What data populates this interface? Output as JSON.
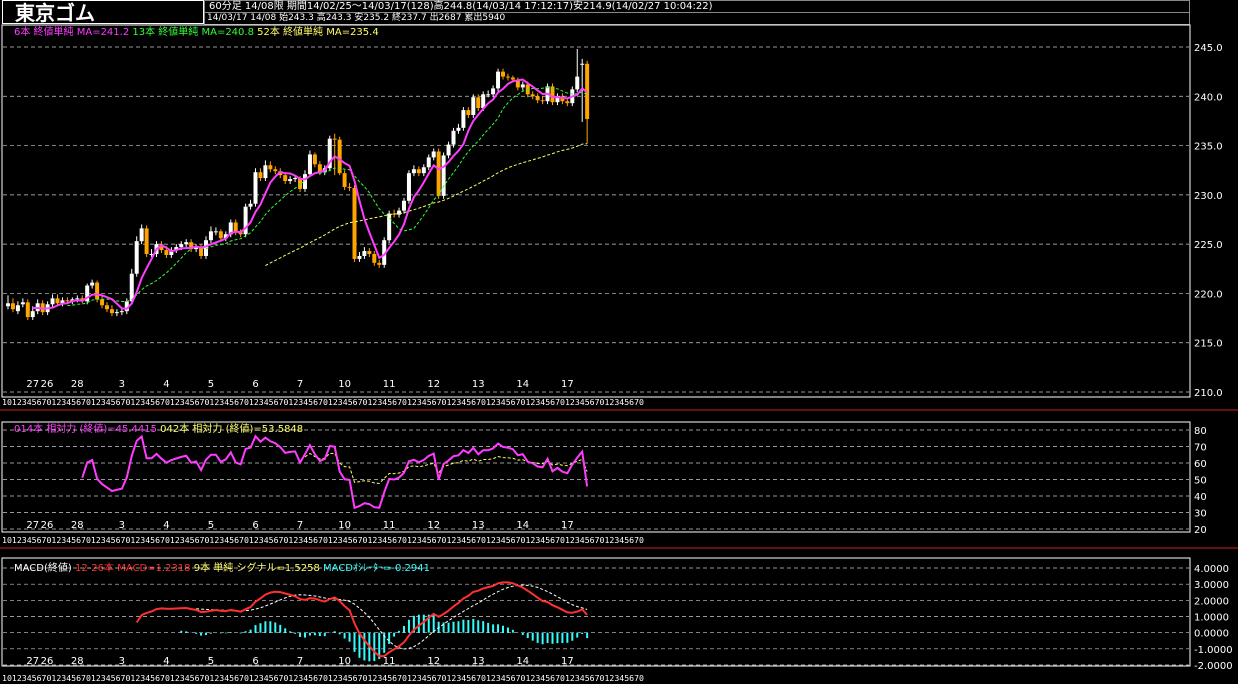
{
  "header": {
    "title": "東京ゴム",
    "info1": "60分足 14/08限 期間14/02/25～14/03/17(128)高244.8(14/03/14 17:12:17)安214.9(14/02/27 10:04:22)",
    "info2": "14/03/17 14/08 始243.3 高243.3 安235.2 終237.7 出2687 累出5940",
    "ma_labels": [
      {
        "text": "6本 終値単純 MA=241.2",
        "color": "#ff3cff"
      },
      {
        "text": "13本 終値単純 MA=240.8",
        "color": "#33ff33"
      },
      {
        "text": "52本 終値単純 MA=235.4",
        "color": "#ffff66"
      }
    ],
    "rsi_labels": [
      {
        "text": "014本 相対力 (終値)=45.4415",
        "color": "#ff3cff"
      },
      {
        "text": "042本 相対力 (終値)=53.5848",
        "color": "#ffff66"
      }
    ],
    "macd_labels": [
      {
        "text": "MACD(終値)",
        "color": "#ffffff"
      },
      {
        "text": "12-26本 MACD=1.2318",
        "color": "#ff3030"
      },
      {
        "text": "9本 単純 シグナル=1.5258",
        "color": "#ffff66"
      },
      {
        "text": "MACDｵｼﾚｰﾀｰ=-0.2941",
        "color": "#33ffff"
      }
    ]
  },
  "hour_ticks": "1012345670123456701234567012345670123456701234567012345670123456701234567012345670123456701234567012345670123456701234567012345670",
  "chart_data": [
    {
      "type": "candlestick",
      "name": "price",
      "ylim": [
        210,
        245
      ],
      "yticks": [
        "245.0",
        "240.0",
        "235.0",
        "230.0",
        "225.0",
        "220.0",
        "215.0",
        "210.0"
      ],
      "days": [
        "26",
        "27",
        "28",
        "3",
        "4",
        "5",
        "6",
        "7",
        "10",
        "11",
        "12",
        "13",
        "14",
        "17"
      ],
      "close": [
        219.0,
        218.4,
        218.8,
        219.1,
        217.6,
        218.2,
        219.0,
        218.1,
        218.9,
        219.5,
        219.0,
        219.3,
        219.2,
        219.4,
        219.5,
        219.2,
        220.8,
        221.1,
        219.4,
        218.8,
        218.4,
        218.0,
        218.1,
        218.2,
        219.2,
        222.0,
        225.3,
        226.6,
        224.0,
        224.0,
        225.0,
        224.4,
        223.9,
        224.4,
        224.7,
        225.0,
        225.2,
        224.5,
        224.7,
        223.8,
        225.4,
        226.3,
        226.3,
        225.6,
        226.0,
        227.2,
        226.2,
        226.0,
        228.8,
        229.1,
        232.3,
        231.7,
        233.0,
        232.6,
        232.4,
        232.0,
        231.4,
        231.6,
        231.7,
        230.6,
        232.1,
        234.1,
        233.1,
        232.3,
        232.7,
        235.7,
        235.6,
        232.2,
        230.8,
        230.7,
        223.5,
        223.8,
        224.3,
        224.0,
        223.1,
        222.9,
        225.4,
        228.1,
        228.0,
        228.4,
        229.4,
        232.2,
        232.6,
        232.2,
        232.8,
        233.8,
        234.4,
        229.9,
        234.0,
        235.1,
        236.5,
        236.8,
        238.6,
        238.1,
        239.9,
        238.8,
        240.2,
        240.2,
        240.8,
        242.5,
        242.0,
        241.9,
        241.7,
        240.9,
        241.2,
        240.2,
        240.0,
        239.6,
        239.5,
        241.0,
        239.4,
        240.0,
        239.5,
        239.3,
        240.7,
        242.0,
        243.3,
        237.7
      ],
      "open": [
        218.7,
        219.0,
        218.2,
        218.9,
        219.1,
        217.6,
        218.2,
        219.0,
        218.1,
        218.9,
        219.5,
        219.0,
        219.3,
        219.2,
        219.4,
        219.5,
        219.2,
        220.8,
        221.1,
        219.4,
        218.8,
        218.4,
        218.0,
        218.1,
        218.2,
        219.2,
        222.0,
        225.3,
        226.6,
        224.0,
        224.0,
        225.0,
        224.4,
        223.9,
        224.4,
        224.7,
        225.0,
        225.2,
        224.5,
        224.7,
        223.8,
        225.4,
        226.3,
        226.3,
        225.6,
        226.0,
        227.2,
        226.2,
        226.0,
        228.8,
        229.1,
        232.3,
        231.7,
        233.0,
        232.6,
        232.4,
        232.0,
        231.4,
        231.6,
        231.7,
        230.6,
        232.1,
        234.1,
        233.1,
        232.3,
        232.7,
        235.7,
        235.6,
        232.2,
        230.8,
        230.7,
        223.5,
        223.8,
        224.3,
        224.0,
        223.1,
        222.9,
        225.4,
        228.1,
        228.0,
        228.4,
        229.4,
        232.2,
        232.6,
        232.2,
        232.8,
        233.8,
        234.4,
        229.9,
        234.0,
        235.1,
        236.5,
        236.8,
        238.6,
        238.1,
        239.9,
        238.8,
        240.2,
        240.2,
        240.8,
        242.5,
        242.0,
        241.9,
        241.7,
        240.9,
        241.2,
        240.2,
        240.0,
        239.6,
        239.5,
        241.0,
        239.4,
        240.0,
        239.5,
        239.3,
        240.7,
        243.3,
        243.3
      ],
      "high": [
        219.8,
        219.5,
        219.2,
        219.5,
        219.4,
        218.7,
        219.4,
        219.3,
        219.2,
        219.9,
        219.9,
        219.6,
        219.6,
        219.6,
        219.8,
        219.8,
        221.0,
        221.4,
        221.3,
        219.7,
        219.1,
        218.8,
        218.4,
        218.5,
        219.5,
        222.5,
        225.8,
        227.0,
        226.9,
        224.5,
        225.3,
        225.3,
        224.8,
        224.7,
        225.0,
        225.3,
        225.5,
        225.5,
        225.0,
        225.0,
        225.8,
        226.8,
        226.7,
        226.5,
        226.3,
        227.5,
        227.5,
        226.5,
        229.1,
        229.5,
        232.7,
        232.7,
        233.5,
        233.4,
        232.9,
        232.7,
        232.3,
        231.9,
        232.0,
        231.9,
        232.5,
        234.5,
        234.3,
        233.4,
        233.0,
        236.0,
        236.2,
        235.9,
        232.5,
        231.2,
        231.0,
        224.2,
        224.7,
        224.6,
        224.3,
        223.4,
        225.7,
        228.4,
        228.5,
        228.7,
        229.7,
        232.5,
        233.0,
        232.9,
        233.1,
        234.1,
        234.7,
        234.7,
        234.3,
        235.4,
        236.8,
        237.2,
        238.9,
        238.9,
        240.2,
        240.2,
        240.5,
        240.6,
        241.1,
        242.8,
        242.8,
        242.3,
        242.1,
        241.9,
        241.5,
        241.5,
        240.5,
        240.3,
        240.0,
        241.3,
        241.3,
        240.3,
        240.3,
        239.8,
        241.0,
        244.8,
        243.8,
        243.6
      ],
      "low": [
        218.4,
        218.1,
        217.9,
        218.6,
        217.3,
        217.3,
        217.9,
        217.8,
        217.8,
        218.6,
        218.7,
        218.7,
        219.0,
        218.9,
        219.1,
        219.0,
        218.9,
        220.5,
        219.1,
        218.5,
        218.1,
        217.7,
        217.7,
        217.8,
        217.9,
        218.9,
        221.7,
        225.0,
        223.7,
        223.7,
        223.7,
        224.1,
        223.6,
        223.6,
        224.1,
        224.4,
        224.7,
        224.2,
        224.2,
        223.5,
        223.5,
        225.1,
        225.9,
        225.3,
        225.3,
        225.7,
        225.9,
        225.7,
        225.7,
        228.5,
        228.8,
        231.4,
        231.4,
        232.3,
        232.1,
        231.7,
        231.1,
        231.1,
        231.3,
        230.3,
        230.3,
        231.8,
        232.8,
        232.0,
        232.0,
        232.4,
        232.0,
        232.0,
        230.5,
        230.4,
        223.2,
        223.2,
        223.5,
        223.7,
        222.8,
        222.6,
        222.6,
        225.1,
        227.7,
        227.7,
        228.1,
        229.1,
        231.9,
        231.9,
        231.9,
        232.5,
        233.5,
        229.6,
        229.6,
        233.7,
        234.8,
        236.2,
        236.5,
        237.8,
        237.8,
        238.5,
        238.5,
        239.9,
        239.9,
        240.5,
        241.7,
        241.6,
        241.4,
        240.6,
        240.6,
        239.9,
        239.7,
        239.3,
        239.2,
        239.2,
        239.1,
        239.1,
        239.2,
        239.0,
        239.0,
        240.4,
        237.4,
        235.2
      ]
    },
    {
      "type": "line",
      "name": "rsi",
      "ylim": [
        20,
        80
      ],
      "yticks": [
        "80",
        "70",
        "60",
        "50",
        "40",
        "30",
        "20"
      ]
    },
    {
      "type": "bar+line",
      "name": "macd",
      "ylim": [
        -2,
        4
      ],
      "yticks": [
        "4.0000",
        "3.0000",
        "2.0000",
        "1.0000",
        "0.0000",
        "-1.0000",
        "-2.0000"
      ]
    }
  ],
  "colors": {
    "up": "#ffffff",
    "down": "#ffa500",
    "ma6": "#ff3cff",
    "ma13": "#33ff33",
    "ma52": "#ffff66",
    "macd": "#ff3030",
    "hist": "#33ffff",
    "grid": "#ffffff",
    "frame": "#ffffff"
  }
}
